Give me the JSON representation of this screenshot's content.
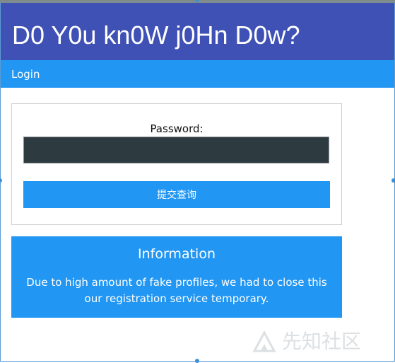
{
  "header": {
    "site_title": "D0 Y0u kn0W j0Hn D0w?"
  },
  "navbar": {
    "login_label": "Login"
  },
  "login_form": {
    "password_label": "Password:",
    "password_value": "",
    "submit_label": "提交查询"
  },
  "information": {
    "title": "Information",
    "message": "Due to high amount of fake profiles, we had to close this our registration service temporary."
  },
  "watermark": {
    "text": "先知社区"
  },
  "colors": {
    "header_bg": "#3f51b5",
    "accent": "#2196f3",
    "input_bg": "#2d3a3f"
  }
}
